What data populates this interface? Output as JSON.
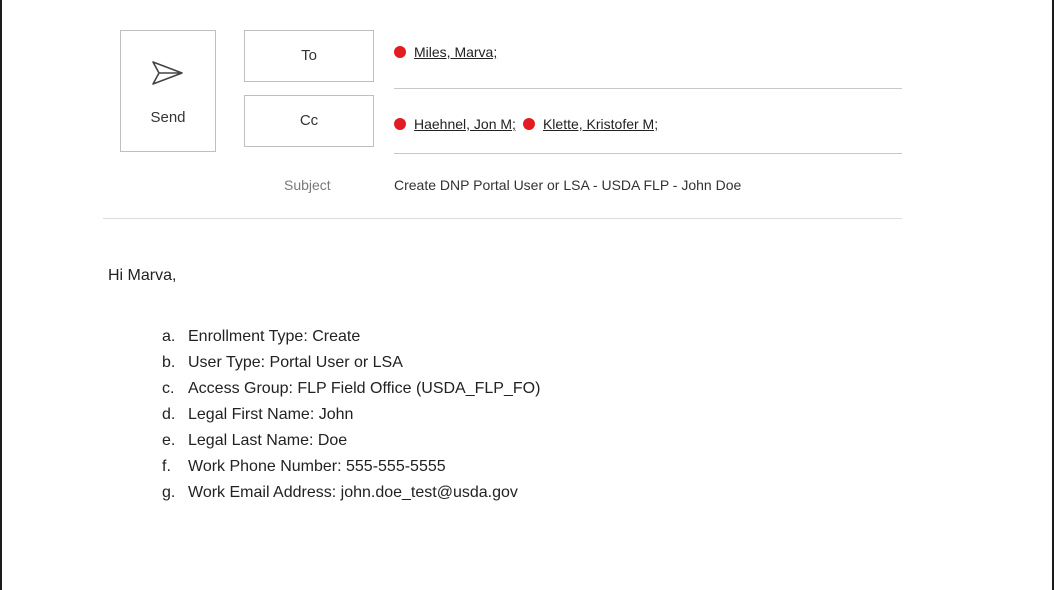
{
  "toolbar": {
    "send_label": "Send"
  },
  "header": {
    "to_label": "To",
    "cc_label": "Cc",
    "subject_label": "Subject",
    "to_recipients": [
      "Miles, Marva;"
    ],
    "cc_recipients": [
      "Haehnel, Jon M;",
      "Klette, Kristofer M;"
    ],
    "subject": "Create DNP Portal User or LSA - USDA FLP - John Doe",
    "presence_color": "#e31b23"
  },
  "body": {
    "greeting": "Hi Marva,",
    "items": [
      {
        "letter": "a.",
        "text": "Enrollment Type: Create"
      },
      {
        "letter": "b.",
        "text": "User Type: Portal User or LSA"
      },
      {
        "letter": "c.",
        "text": "Access Group: FLP Field Office (USDA_FLP_FO)"
      },
      {
        "letter": "d.",
        "text": "Legal First Name: John"
      },
      {
        "letter": "e.",
        "text": "Legal Last Name: Doe"
      },
      {
        "letter": "f.",
        "text": "Work Phone Number: 555-555-5555"
      },
      {
        "letter": "g.",
        "text": "Work Email Address: john.doe_test@usda.gov"
      }
    ]
  }
}
